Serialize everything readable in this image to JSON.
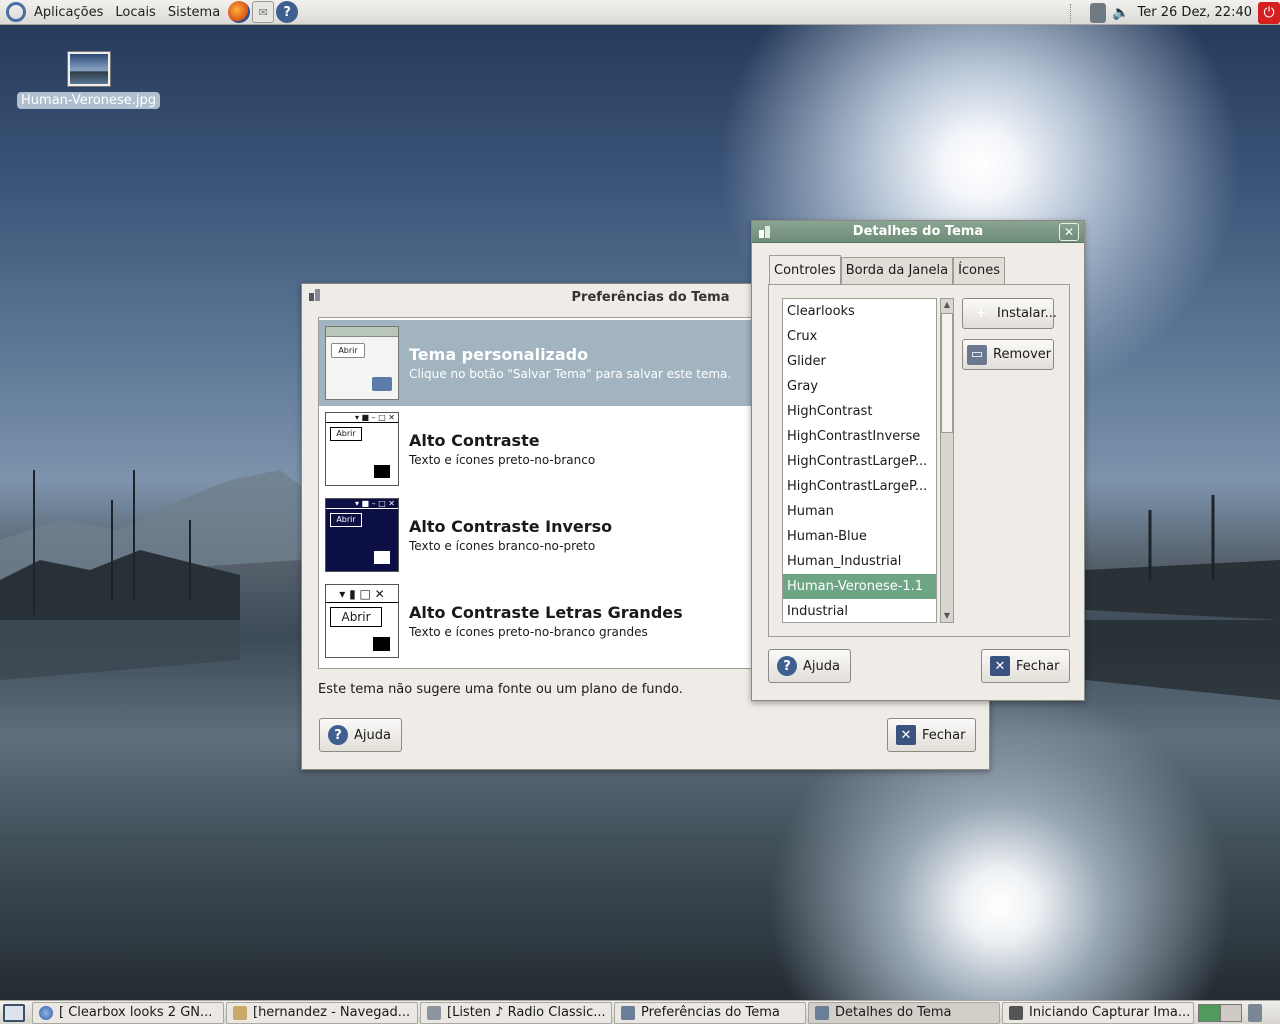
{
  "top_panel": {
    "menus": [
      "Aplicações",
      "Locais",
      "Sistema"
    ],
    "clock": "Ter 26 Dez, 22:40"
  },
  "desktop": {
    "icon_label": "Human-Veronese.jpg"
  },
  "prefs_window": {
    "title": "Preferências do Tema",
    "themes": [
      {
        "name": "Tema personalizado",
        "desc": "Clique no botão \"Salvar Tema\" para salvar este tema."
      },
      {
        "name": "Alto Contraste",
        "desc": "Texto e ícones preto-no-branco"
      },
      {
        "name": "Alto Contraste Inverso",
        "desc": "Texto e ícones branco-no-preto"
      },
      {
        "name": "Alto Contraste Letras Grandes",
        "desc": "Texto e ícones preto-no-branco grandes"
      }
    ],
    "preview_button_label": "Abrir",
    "note": "Este tema não sugere uma fonte ou um plano de fundo.",
    "help_label": "Ajuda",
    "close_label": "Fechar"
  },
  "details_window": {
    "title": "Detalhes do Tema",
    "tabs": [
      "Controles",
      "Borda da Janela",
      "Ícones"
    ],
    "controls": [
      "Clearlooks",
      "Crux",
      "Glider",
      "Gray",
      "HighContrast",
      "HighContrastInverse",
      "HighContrastLargeP...",
      "HighContrastLargeP...",
      "Human",
      "Human-Blue",
      "Human_Industrial",
      "Human-Veronese-1.1",
      "Industrial"
    ],
    "selected_control": "Human-Veronese-1.1",
    "install_label": "Instalar...",
    "remove_label": "Remover",
    "help_label": "Ajuda",
    "close_label": "Fechar"
  },
  "taskbar": {
    "tasks": [
      "[ Clearbox looks 2 GN...",
      "[hernandez - Navegad...",
      "[Listen ♪ Radio Classic...",
      "Preferências do Tema",
      "Detalhes do Tema",
      "Iniciando Capturar Ima..."
    ],
    "active_task": "Detalhes do Tema"
  },
  "colors": {
    "selection_green": "#6ea585",
    "selection_blue_gray": "#a2b4bf",
    "titlebar_green": "#7d9b86"
  }
}
